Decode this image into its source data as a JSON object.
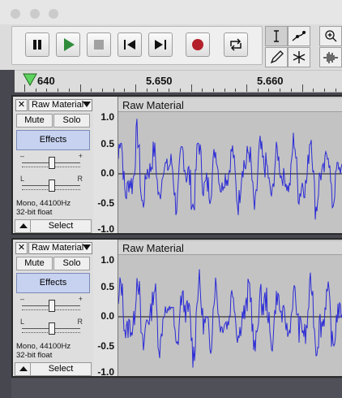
{
  "toolbar": {
    "transport_buttons": [
      "pause-icon",
      "play-icon",
      "stop-icon",
      "skip-start-icon",
      "skip-end-icon",
      "record-icon",
      "loop-icon"
    ],
    "tools": [
      "selection-tool-icon",
      "envelope-tool-icon",
      "draw-tool-icon",
      "multi-tool-icon"
    ],
    "extra_tools": [
      "zoom-in-icon",
      "zoom-toggle-icon"
    ],
    "accent_colors": {
      "play": "#2f8c3a",
      "record": "#b4202a",
      "waveform": "#2b2bd6"
    }
  },
  "ruler": {
    "labels": [
      "640",
      "5.650",
      "5.660"
    ]
  },
  "tracks": [
    {
      "name": "Raw Material",
      "title": "Raw Material",
      "mute_label": "Mute",
      "solo_label": "Solo",
      "effects_label": "Effects",
      "gain_minus": "–",
      "gain_plus": "+",
      "pan_left": "L",
      "pan_right": "R",
      "info_line1": "Mono, 44100Hz",
      "info_line2": "32-bit float",
      "select_label": "Select",
      "scale": [
        "1.0",
        "0.5",
        "0.0",
        "-0.5",
        "-1.0"
      ]
    },
    {
      "name": "Raw Material",
      "title": "Raw Material",
      "mute_label": "Mute",
      "solo_label": "Solo",
      "effects_label": "Effects",
      "gain_minus": "–",
      "gain_plus": "+",
      "pan_left": "L",
      "pan_right": "R",
      "info_line1": "Mono, 44100Hz",
      "info_line2": "32-bit float",
      "select_label": "Select",
      "scale": [
        "1.0",
        "0.5",
        "0.0",
        "-0.5",
        "-1.0"
      ]
    }
  ]
}
